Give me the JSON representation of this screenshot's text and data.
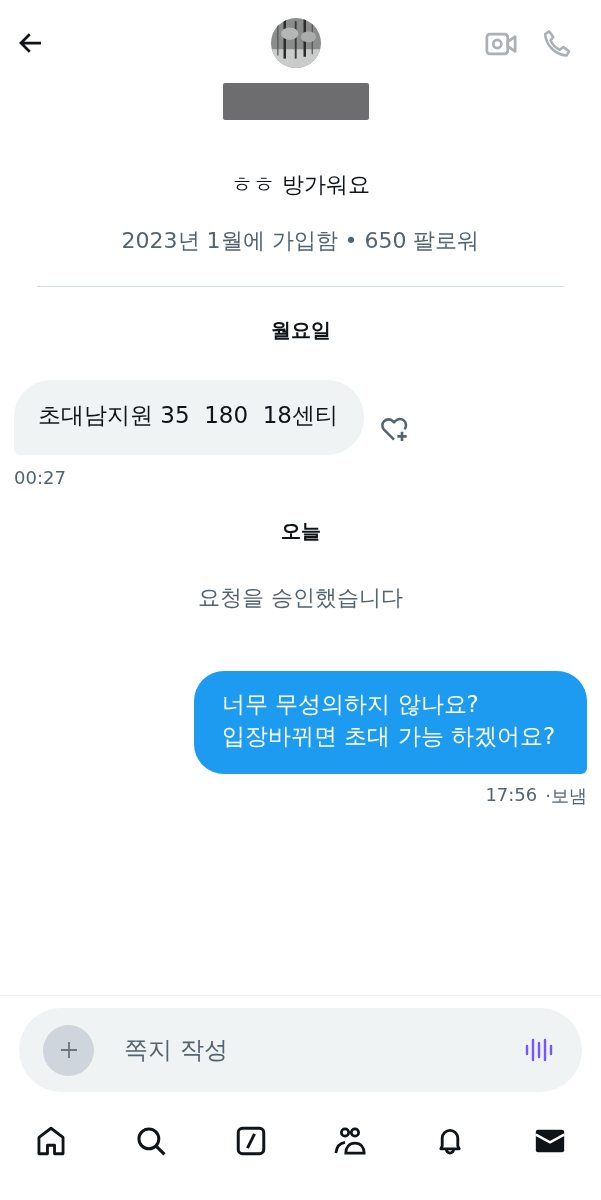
{
  "header": {
    "name_redacted": true
  },
  "profile": {
    "bio": "ㅎㅎ 방가워요",
    "meta": "2023년 1월에 가입함 • 650 팔로워"
  },
  "conversation": [
    {
      "kind": "date",
      "text": "월요일"
    },
    {
      "kind": "received",
      "text": "초대남지원 35  180  18센티",
      "time": "00:27"
    },
    {
      "kind": "date",
      "text": "오늘"
    },
    {
      "kind": "system",
      "text": "요청을 승인했습니다"
    },
    {
      "kind": "sent",
      "text": "너무 무성의하지 않나요?\n입장바뀌면 초대 가능 하겠어요?",
      "time": "17:56",
      "status": "·보냄"
    }
  ],
  "composer": {
    "placeholder": "쪽지 작성"
  },
  "nav": [
    {
      "kind": "home",
      "selected": false
    },
    {
      "kind": "search",
      "selected": false
    },
    {
      "kind": "compose",
      "selected": false
    },
    {
      "kind": "communities",
      "selected": false
    },
    {
      "kind": "notifications",
      "selected": false
    },
    {
      "kind": "messages",
      "selected": true
    }
  ]
}
